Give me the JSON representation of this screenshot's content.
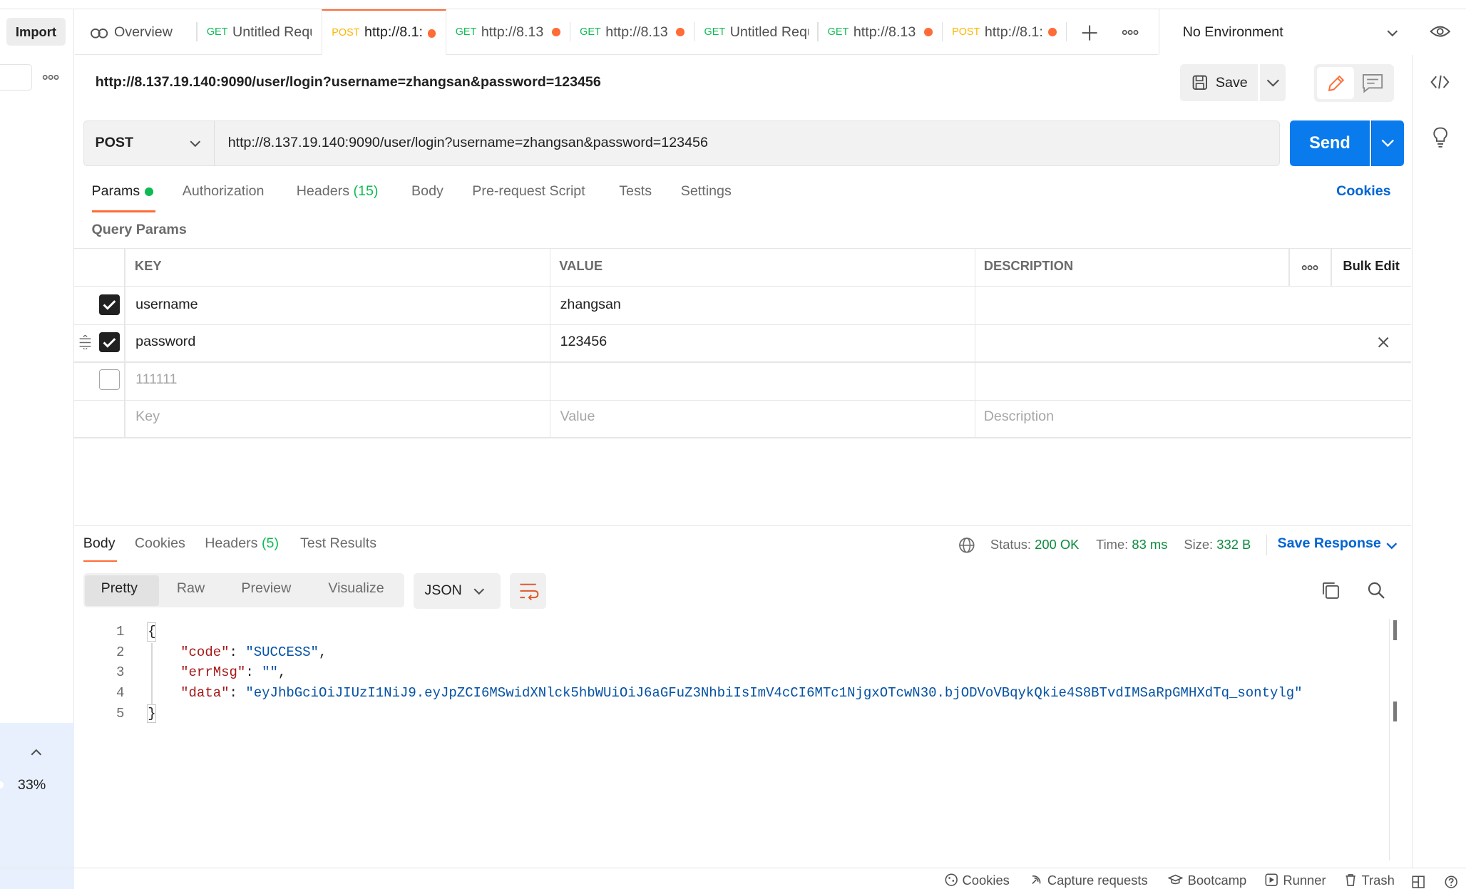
{
  "sidebar": {
    "import_label": "Import",
    "zoom_percent": "33%"
  },
  "tabs": [
    {
      "method": "",
      "label": "Overview",
      "dirty": false
    },
    {
      "method": "GET",
      "label": "Untitled Requ",
      "dirty": false
    },
    {
      "method": "POST",
      "label": "http://8.1:",
      "dirty": true,
      "active": true
    },
    {
      "method": "GET",
      "label": "http://8.13",
      "dirty": true
    },
    {
      "method": "GET",
      "label": "http://8.13",
      "dirty": true
    },
    {
      "method": "GET",
      "label": "Untitled Requ",
      "dirty": false
    },
    {
      "method": "GET",
      "label": "http://8.13",
      "dirty": true
    },
    {
      "method": "POST",
      "label": "http://8.1:",
      "dirty": true
    }
  ],
  "environment": {
    "label": "No Environment"
  },
  "request": {
    "title": "http://8.137.19.140:9090/user/login?username=zhangsan&password=123456",
    "save_label": "Save",
    "method": "POST",
    "url": "http://8.137.19.140:9090/user/login?username=zhangsan&password=123456",
    "send_label": "Send"
  },
  "request_tabs": {
    "params": "Params",
    "authorization": "Authorization",
    "headers": "Headers",
    "headers_count": "(15)",
    "body": "Body",
    "prerequest": "Pre-request Script",
    "tests": "Tests",
    "settings": "Settings",
    "cookies": "Cookies"
  },
  "params": {
    "section_title": "Query Params",
    "headers": {
      "key": "KEY",
      "value": "VALUE",
      "description": "DESCRIPTION",
      "bulk_edit": "Bulk Edit"
    },
    "rows": [
      {
        "checked": true,
        "key": "username",
        "value": "zhangsan",
        "description": ""
      },
      {
        "checked": true,
        "key": "password",
        "value": "123456",
        "description": ""
      },
      {
        "checked": false,
        "key": "111111",
        "value": "",
        "description": ""
      }
    ],
    "placeholders": {
      "key": "Key",
      "value": "Value",
      "description": "Description"
    }
  },
  "response": {
    "tabs": {
      "body": "Body",
      "cookies": "Cookies",
      "headers": "Headers",
      "headers_count": "(5)",
      "test_results": "Test Results"
    },
    "status_label": "Status:",
    "status_value": "200 OK",
    "time_label": "Time:",
    "time_value": "83 ms",
    "size_label": "Size:",
    "size_value": "332 B",
    "save_response": "Save Response",
    "views": {
      "pretty": "Pretty",
      "raw": "Raw",
      "preview": "Preview",
      "visualize": "Visualize"
    },
    "format": "JSON",
    "line_numbers": [
      "1",
      "2",
      "3",
      "4",
      "5"
    ],
    "body_lines": {
      "open": "{",
      "code_key": "\"code\"",
      "code_val": "\"SUCCESS\"",
      "errmsg_key": "\"errMsg\"",
      "errmsg_val": "\"\"",
      "data_key": "\"data\"",
      "data_val": "\"eyJhbGciOiJIUzI1NiJ9.eyJpZCI6MSwidXNlck5hbWUiOiJ6aGFuZ3NhbiIsImV4cCI6MTc1NjgxOTcwN30.bjODVoVBqykQkie4S8BTvdIMSaRpGMHXdTq_sontylg\"",
      "close": "}"
    }
  },
  "statusbar": {
    "cookies": "Cookies",
    "capture": "Capture requests",
    "bootcamp": "Bootcamp",
    "runner": "Runner",
    "trash": "Trash"
  },
  "colors": {
    "accent": "#ff6c37",
    "send": "#097bed",
    "link": "#0265d2",
    "success": "#0c8a3e"
  }
}
